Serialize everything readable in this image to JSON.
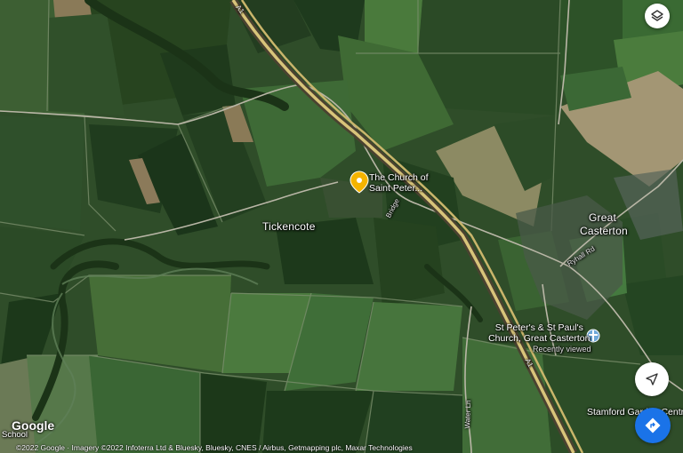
{
  "places": {
    "tickencote": "Tickencote",
    "great_casterton_line1": "Great",
    "great_casterton_line2": "Casterton",
    "school": "School"
  },
  "pois": {
    "church_saint_peter_line1": "The Church of",
    "church_saint_peter_line2": "Saint Peter...",
    "st_peters_line1": "St Peter's & St Paul's",
    "st_peters_line2": "Church, Great Casterton",
    "st_peters_sub": "Recently viewed",
    "stamford_garden": "Stamford Garden Centre"
  },
  "roads": {
    "a1_top": "A1",
    "a1_bottom": "A1",
    "bridge": "Bridge",
    "ryhall_rd": "Ryhall Rd",
    "water_ln": "Water Ln"
  },
  "controls": {
    "layers_icon": "layers-icon",
    "compass_icon": "navigation-arrow-icon",
    "directions_icon": "directions-icon"
  },
  "attribution": {
    "logo": "Google",
    "copyright": "©2022 Google · Imagery ©2022 Infoterra Ltd & Bluesky, Bluesky, CNES / Airbus, Getmapping plc, Maxar Technologies"
  },
  "colors": {
    "poi_pin": "#f4b400",
    "directions_button": "#1a73e8"
  }
}
